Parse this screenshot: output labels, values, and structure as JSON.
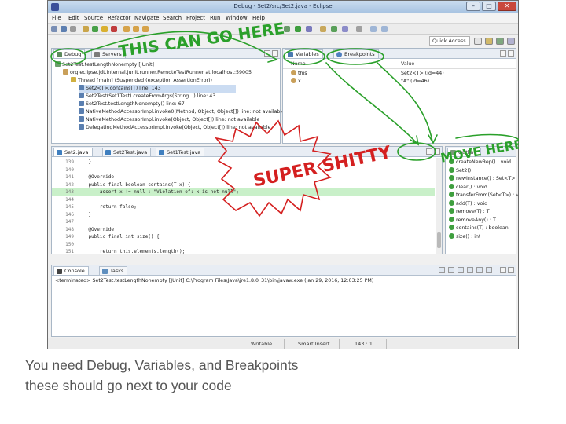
{
  "window": {
    "title": "Debug - Set2/src/Set2.java - Eclipse",
    "controls": {
      "minimize": "–",
      "maximize": "□",
      "close": "✕"
    }
  },
  "menubar": [
    "File",
    "Edit",
    "Source",
    "Refactor",
    "Navigate",
    "Search",
    "Project",
    "Run",
    "Window",
    "Help"
  ],
  "toolbar": {
    "quick_access": "Quick Access"
  },
  "debug_pane": {
    "tabs": [
      "Debug",
      "Servers"
    ],
    "rows": [
      "Set2Test.testLengthNonempty [JUnit]",
      "org.eclipse.jdt.internal.junit.runner.RemoteTestRunner at localhost:59005",
      "Thread [main] (Suspended (exception AssertionError))",
      "Set2<T>.contains(T) line: 143",
      "Set2Test(Set1Test).createFromArgs(String...) line: 43",
      "Set2Test.testLengthNonempty() line: 67",
      "NativeMethodAccessorImpl.invoke0(Method, Object, Object[]) line: not available",
      "NativeMethodAccessorImpl.invoke(Object, Object[]) line: not available",
      "DelegatingMethodAccessorImpl.invoke(Object, Object[]) line: not available"
    ]
  },
  "variables_pane": {
    "tabs": [
      "Variables",
      "Breakpoints"
    ],
    "columns": [
      "Name",
      "Value"
    ],
    "rows": [
      {
        "name": "this",
        "value": "Set2<T> (id=44)"
      },
      {
        "name": "x",
        "value": "\"A\" (id=46)"
      }
    ]
  },
  "editor": {
    "tabs": [
      "Set2.java",
      "Set2Test.java",
      "Set1Test.java"
    ],
    "lines": [
      {
        "no": "139",
        "code": "    }",
        "highlight": false
      },
      {
        "no": "140",
        "code": "",
        "highlight": false
      },
      {
        "no": "141",
        "code": "    @Override",
        "highlight": false
      },
      {
        "no": "142",
        "code": "    public final boolean contains(T x) {",
        "highlight": false
      },
      {
        "no": "143",
        "code": "        assert x != null : \"Violation of: x is not null\";",
        "highlight": true
      },
      {
        "no": "144",
        "code": "",
        "highlight": false
      },
      {
        "no": "145",
        "code": "        return false;",
        "highlight": false
      },
      {
        "no": "146",
        "code": "    }",
        "highlight": false
      },
      {
        "no": "147",
        "code": "",
        "highlight": false
      },
      {
        "no": "148",
        "code": "    @Override",
        "highlight": false
      },
      {
        "no": "149",
        "code": "    public final int size() {",
        "highlight": false
      },
      {
        "no": "150",
        "code": "",
        "highlight": false
      },
      {
        "no": "151",
        "code": "        return this.elements.length();",
        "highlight": false
      }
    ]
  },
  "outline_pane": {
    "tabs": [
      "Outline"
    ],
    "rows": [
      "createNewRep() : void",
      "Set2()",
      "newInstance() : Set<T>",
      "clear() : void",
      "transferFrom(Set<T>) : void",
      "add(T) : void",
      "remove(T) : T",
      "removeAny() : T",
      "contains(T) : boolean",
      "size() : int"
    ]
  },
  "console_pane": {
    "tabs": [
      "Console",
      "Tasks"
    ],
    "launch_line": "<terminated> Set2Test.testLengthNonempty [JUnit] C:\\Program Files\\Java\\jre1.8.0_31\\bin\\javaw.exe (Jan 29, 2016, 12:03:25 PM)"
  },
  "statusbar": {
    "mode": "Writable",
    "insert": "Smart Insert",
    "position": "143 : 1"
  },
  "annotations": {
    "note1": "THIS CAN GO HERE",
    "note2": "SUPER SHITTY",
    "note3": "MOVE HERE",
    "color_green": "#2aa02a",
    "color_red": "#d42020"
  },
  "caption": {
    "line1": "You need Debug, Variables, and Breakpoints",
    "line2": "these should go next to your code"
  }
}
